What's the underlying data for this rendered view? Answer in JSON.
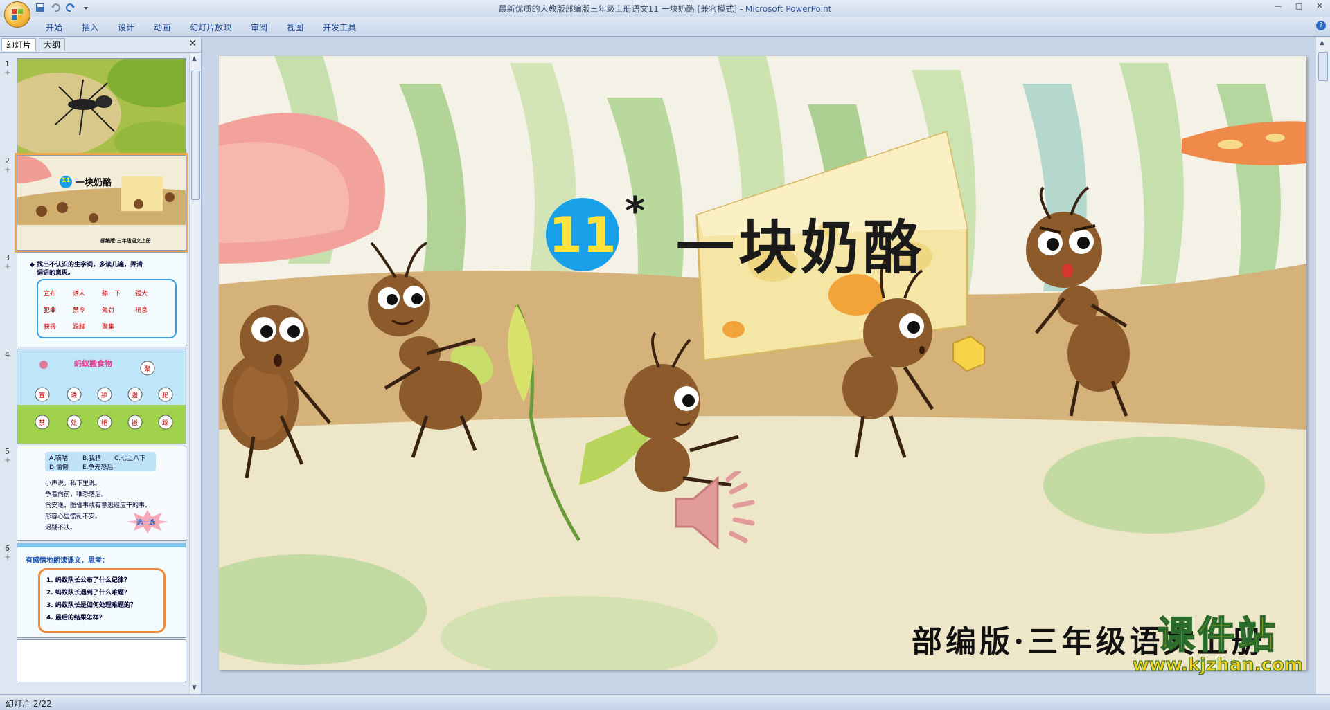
{
  "window": {
    "title": "最新优质的人教版部编版三年级上册语文11 一块奶酪 [兼容模式]",
    "app_name": "Microsoft PowerPoint",
    "controls": [
      "—",
      "□",
      "✕"
    ]
  },
  "ribbon": {
    "tabs": [
      "开始",
      "插入",
      "设计",
      "动画",
      "幻灯片放映",
      "审阅",
      "视图",
      "开发工具"
    ]
  },
  "left_pane": {
    "tabs": [
      "幻灯片",
      "大纲"
    ],
    "close": "✕",
    "thumbnails": [
      {
        "num": "1",
        "texts": []
      },
      {
        "num": "2",
        "texts": [
          "11",
          "一块奶酪",
          "部编版·三年级语文上册"
        ],
        "selected": true
      },
      {
        "num": "3",
        "texts": [
          "◆ 找出不认识的生字词，多读几遍，弄清",
          "词语的意思。",
          "宣布",
          "诱人",
          "舔一下",
          "强大",
          "犯罪",
          "禁令",
          "处罚",
          "稍息",
          "获得",
          "跺脚",
          "聚集"
        ]
      },
      {
        "num": "4",
        "texts": [
          "蚂蚁搬食物",
          "聚",
          "宣",
          "诱",
          "舔",
          "强",
          "犯",
          "禁",
          "处",
          "稍",
          "搬",
          "跺"
        ]
      },
      {
        "num": "5",
        "texts": [
          "A.嘀咕",
          "B.我猜",
          "C.七上八下",
          "D.偷懒",
          "E.争先恐后",
          "小声说，私下里说。",
          "争着向前，唯恐落后。",
          "贪安逸，图省事或有意逃避应干的事。",
          "形容心里慌乱不安。",
          "迟疑不决。",
          "选一选"
        ]
      },
      {
        "num": "6",
        "texts": [
          "有感情地朗读课文，思考：",
          "1. 蚂蚁队长公布了什么纪律？",
          "2. 蚂蚁队长遇到了什么难题？",
          "3. 蚂蚁队长是如何处理难题的？",
          "4. 最后的结果怎样？"
        ]
      }
    ]
  },
  "slide": {
    "lesson_number": "11",
    "star": "*",
    "title": "一块奶酪",
    "edition": "部编版·三年级语文上册",
    "watermark_title": "课件站",
    "watermark_url": "www.kjzhan.com"
  },
  "status": {
    "slide_indicator": "幻灯片 2/22"
  }
}
